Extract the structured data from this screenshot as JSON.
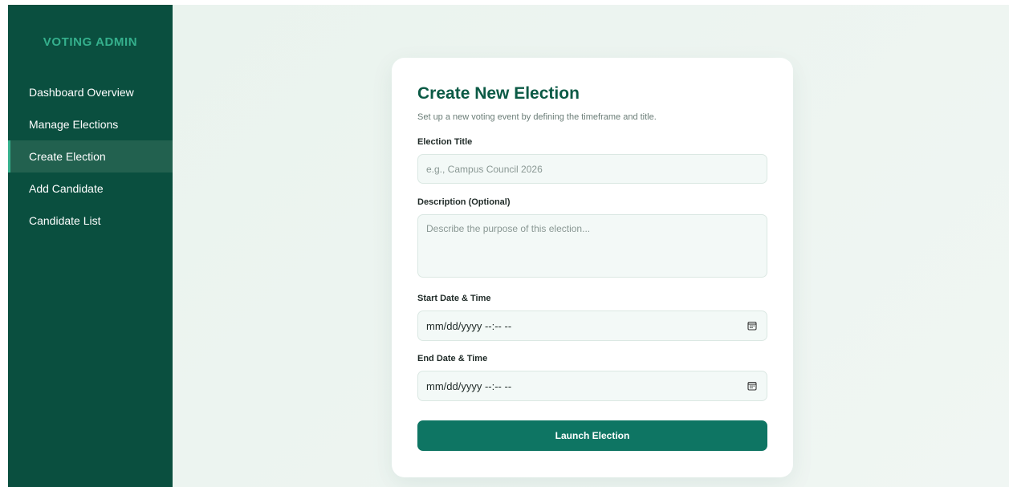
{
  "sidebar": {
    "brand": "VOTING ADMIN",
    "items": [
      {
        "label": "Dashboard Overview",
        "active": false
      },
      {
        "label": "Manage Elections",
        "active": false
      },
      {
        "label": "Create Election",
        "active": true
      },
      {
        "label": "Add Candidate",
        "active": false
      },
      {
        "label": "Candidate List",
        "active": false
      }
    ]
  },
  "form": {
    "title": "Create New Election",
    "subtitle": "Set up a new voting event by defining the timeframe and title.",
    "election_title": {
      "label": "Election Title",
      "placeholder": "e.g., Campus Council 2026",
      "value": ""
    },
    "description": {
      "label": "Description (Optional)",
      "placeholder": "Describe the purpose of this election...",
      "value": ""
    },
    "start": {
      "label": "Start Date & Time",
      "value": "mm/dd/yyyy --:-- --"
    },
    "end": {
      "label": "End Date & Time",
      "value": "mm/dd/yyyy --:-- --"
    },
    "submit_label": "Launch Election"
  },
  "icons": {
    "date_picker": "calendar-icon"
  },
  "colors": {
    "sidebar_bg": "#0a4f3f",
    "brand_accent": "#35b08d",
    "primary_button": "#0e7563",
    "title": "#0b5a45"
  }
}
